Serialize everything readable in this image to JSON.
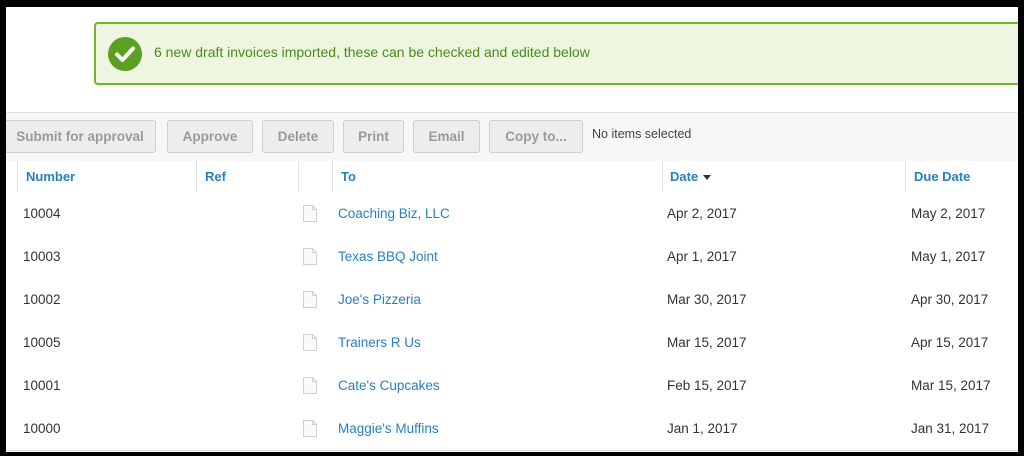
{
  "banner": {
    "message": "6 new draft invoices imported, these can be checked and edited below",
    "icon": "check-circle-icon",
    "color": "#5aa021"
  },
  "toolbar": {
    "buttons": [
      {
        "label": "Submit for approval"
      },
      {
        "label": "Approve"
      },
      {
        "label": "Delete"
      },
      {
        "label": "Print"
      },
      {
        "label": "Email"
      },
      {
        "label": "Copy to..."
      }
    ],
    "selection_status": "No items selected"
  },
  "table": {
    "columns": {
      "number": "Number",
      "ref": "Ref",
      "to": "To",
      "date": "Date",
      "due_date": "Due Date"
    },
    "sort_column": "date",
    "sort_direction": "descending",
    "rows": [
      {
        "number": "10004",
        "ref": "",
        "to": "Coaching Biz, LLC",
        "date": "Apr 2, 2017",
        "due_date": "May 2, 2017"
      },
      {
        "number": "10003",
        "ref": "",
        "to": "Texas BBQ Joint",
        "date": "Apr 1, 2017",
        "due_date": "May 1, 2017"
      },
      {
        "number": "10002",
        "ref": "",
        "to": "Joe's Pizzeria",
        "date": "Mar 30, 2017",
        "due_date": "Apr 30, 2017"
      },
      {
        "number": "10005",
        "ref": "",
        "to": "Trainers R Us",
        "date": "Mar 15, 2017",
        "due_date": "Apr 15, 2017"
      },
      {
        "number": "10001",
        "ref": "",
        "to": "Cate's Cupcakes",
        "date": "Feb 15, 2017",
        "due_date": "Mar 15, 2017"
      },
      {
        "number": "10000",
        "ref": "",
        "to": "Maggie's Muffins",
        "date": "Jan 1, 2017",
        "due_date": "Jan 31, 2017"
      }
    ]
  },
  "colors": {
    "link": "#2a7fbf",
    "banner_border": "#72b72a",
    "banner_text": "#4b8a19"
  }
}
